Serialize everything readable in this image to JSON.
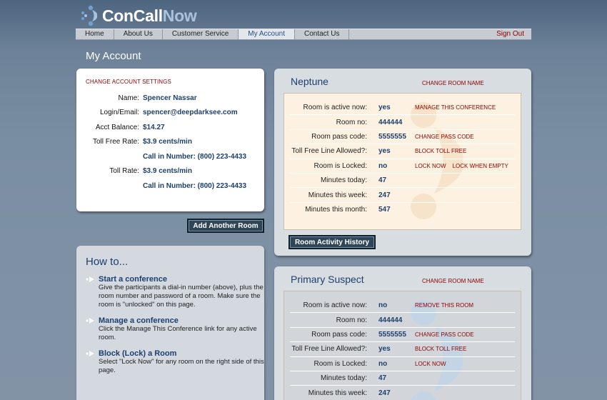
{
  "brand": {
    "con_call": "ConCall",
    "now": "Now",
    "logo_icon": "conference-burst-icon"
  },
  "nav": {
    "items": [
      {
        "label": "Home"
      },
      {
        "label": "About Us"
      },
      {
        "label": "Customer Service"
      },
      {
        "label": "My Account",
        "active": true
      },
      {
        "label": "Contact Us"
      }
    ],
    "sign_out": "Sign Out"
  },
  "page_title": "My Account",
  "account": {
    "settings_link": "CHANGE ACCOUNT SETTINGS",
    "rows": [
      {
        "label": "Name:",
        "value": "Spencer Nassar"
      },
      {
        "label": "Login/Email:",
        "value": "spencer@deepdarksee.com"
      },
      {
        "label": "Acct Balance:",
        "value": "$14.27"
      },
      {
        "label": "Toll Free Rate:",
        "value": "$3.9 cents/min"
      },
      {
        "label": "",
        "value": "Call in Number: (800) 223-4433"
      },
      {
        "label": "Toll Rate:",
        "value": "$3.9 cents/min"
      },
      {
        "label": "",
        "value": "Call in Number: (800) 223-4433"
      }
    ]
  },
  "add_room_button": "Add Another Room",
  "howto": {
    "title": "How to...",
    "items": [
      {
        "heading": "Start a conference",
        "body": "Give the participants a dial-in number (above), plus the room number and password of a room. Make sure the room is \"unlocked\" on this page."
      },
      {
        "heading": "Manage a conference",
        "body": "Click the Manage This Conference link for any active room."
      },
      {
        "heading": "Block (Lock) a Room",
        "body": "Select \"Lock Now\" for any room on the right side of this page."
      }
    ]
  },
  "rooms": [
    {
      "name": "Neptune",
      "rename_link": "CHANGE ROOM NAME",
      "rows": [
        {
          "label": "Room is active now:",
          "value": "yes",
          "actions": [
            "MANAGE THIS CONFERENCE"
          ]
        },
        {
          "label": "Room no:",
          "value": "444444",
          "actions": []
        },
        {
          "label": "Room pass code:",
          "value": "5555555",
          "actions": [
            "CHANGE PASS CODE"
          ]
        },
        {
          "label": "Toll Free Line Allowed?:",
          "value": "yes",
          "actions": [
            "BLOCK TOLL FREE"
          ]
        },
        {
          "label": "Room is Locked:",
          "value": "no",
          "actions": [
            "LOCK NOW",
            "LOCK WHEN EMPTY"
          ]
        },
        {
          "label": "Minutes today:",
          "value": "47",
          "actions": []
        },
        {
          "label": "Minutes this week:",
          "value": "247",
          "actions": []
        },
        {
          "label": "Minutes this month:",
          "value": "547",
          "actions": []
        }
      ],
      "history_button": "Room Activity History"
    },
    {
      "name": "Primary Suspect",
      "rename_link": "CHANGE ROOM NAME",
      "rows": [
        {
          "label": "Room is active now:",
          "value": "no",
          "actions": [
            "REMOVE THIS ROOM"
          ]
        },
        {
          "label": "Room no:",
          "value": "444444",
          "actions": []
        },
        {
          "label": "Room pass code:",
          "value": "5555555",
          "actions": [
            "CHANGE PASS CODE"
          ]
        },
        {
          "label": "Toll Free Line Allowed?:",
          "value": "yes",
          "actions": [
            "BLOCK TOLL FREE"
          ]
        },
        {
          "label": "Room is Locked:",
          "value": "no",
          "actions": [
            "LOCK NOW"
          ]
        },
        {
          "label": "Minutes today:",
          "value": "47",
          "actions": []
        },
        {
          "label": "Minutes this week:",
          "value": "247",
          "actions": []
        }
      ]
    }
  ]
}
